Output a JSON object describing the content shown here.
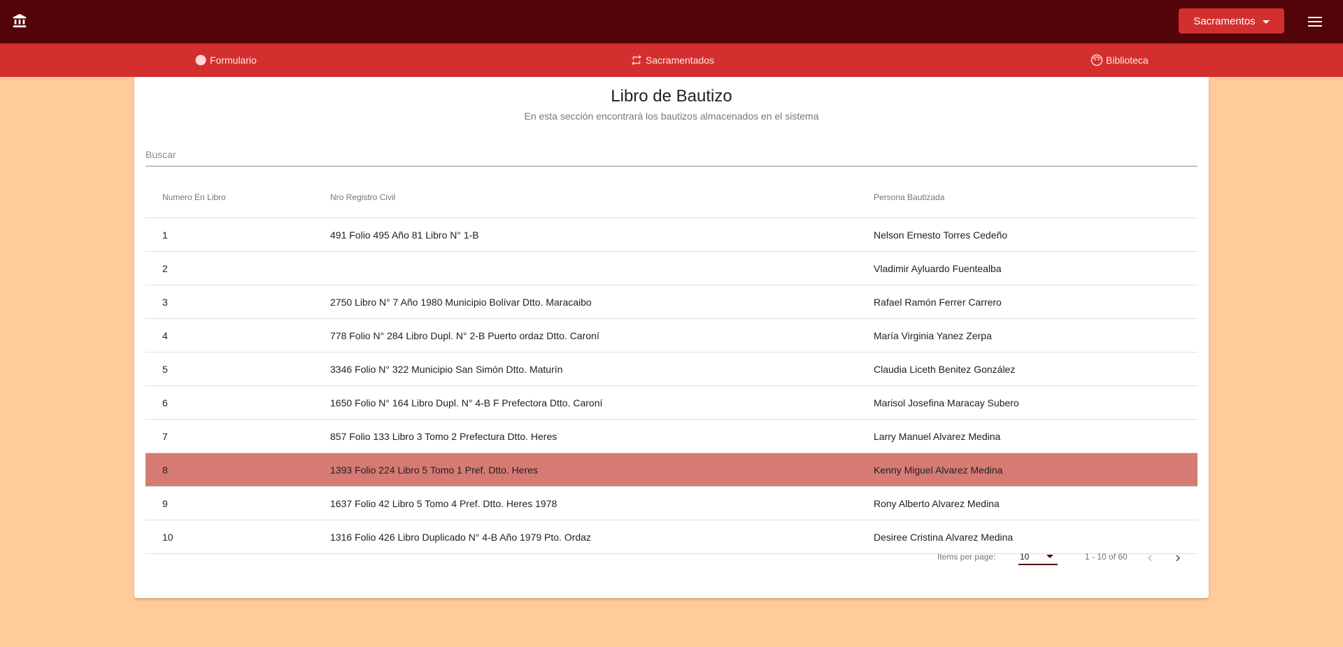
{
  "header": {
    "sacramentos_label": "Sacramentos"
  },
  "nav": {
    "items": [
      {
        "label": "Formulario",
        "icon": "circle-icon"
      },
      {
        "label": "Sacramentados",
        "icon": "swap-icon"
      },
      {
        "label": "Biblioteca",
        "icon": "face-icon"
      }
    ]
  },
  "page": {
    "title": "Libro de Bautizo",
    "subtitle": "En esta sección encontrará los bautizos almacenados en el sistema"
  },
  "search": {
    "placeholder": "Buscar",
    "value": ""
  },
  "table": {
    "columns": [
      "Numero En Libro",
      "Nro Registro Civil",
      "Persona Bautizada"
    ],
    "rows": [
      {
        "num": "1",
        "registro": "491 Folio 495 Año 81 Libro N° 1-B",
        "persona": "Nelson Ernesto Torres Cedeño"
      },
      {
        "num": "2",
        "registro": "",
        "persona": "Vladimir Ayluardo Fuentealba"
      },
      {
        "num": "3",
        "registro": "2750 Libro N° 7 Año 1980 Municipio Bolívar Dtto. Maracaibo",
        "persona": "Rafael Ramón Ferrer Carrero"
      },
      {
        "num": "4",
        "registro": "778 Folio N° 284 Libro Dupl. N° 2-B Puerto ordaz Dtto. Caroní",
        "persona": "María Virginia Yanez Zerpa"
      },
      {
        "num": "5",
        "registro": "3346 Folio N° 322 Municipio San Simón Dtto. Maturín",
        "persona": "Claudia Liceth Benitez González"
      },
      {
        "num": "6",
        "registro": "1650 Folio N° 164 Libro Dupl. N° 4-B F Prefectora Dtto. Caroní",
        "persona": "Marisol Josefina Maracay Subero"
      },
      {
        "num": "7",
        "registro": "857 Folio 133 Libro 3 Tomo 2 Prefectura Dtto. Heres",
        "persona": "Larry Manuel Alvarez Medina"
      },
      {
        "num": "8",
        "registro": "1393 Folio 224 Libro 5 Tomo 1 Pref. Dtto. Heres",
        "persona": "Kenny Miguel Alvarez Medina"
      },
      {
        "num": "9",
        "registro": "1637 Folio 42 Libro 5 Tomo 4 Pref. Dtto. Heres 1978",
        "persona": "Rony Alberto Alvarez Medina"
      },
      {
        "num": "10",
        "registro": "1316 Folio 426 Libro Duplicado N° 4-B Año 1979 Pto. Ordaz",
        "persona": "Desiree Cristina Alvarez Medina"
      }
    ],
    "selected_index": 7
  },
  "paginator": {
    "items_per_page_label": "Items per page:",
    "items_per_page": "10",
    "range_label": "1 - 10 of 60"
  },
  "colors": {
    "topbar": "#520408",
    "navbar": "#d32f2f",
    "background": "#ffcc99",
    "selected_row": "#d67b74"
  }
}
